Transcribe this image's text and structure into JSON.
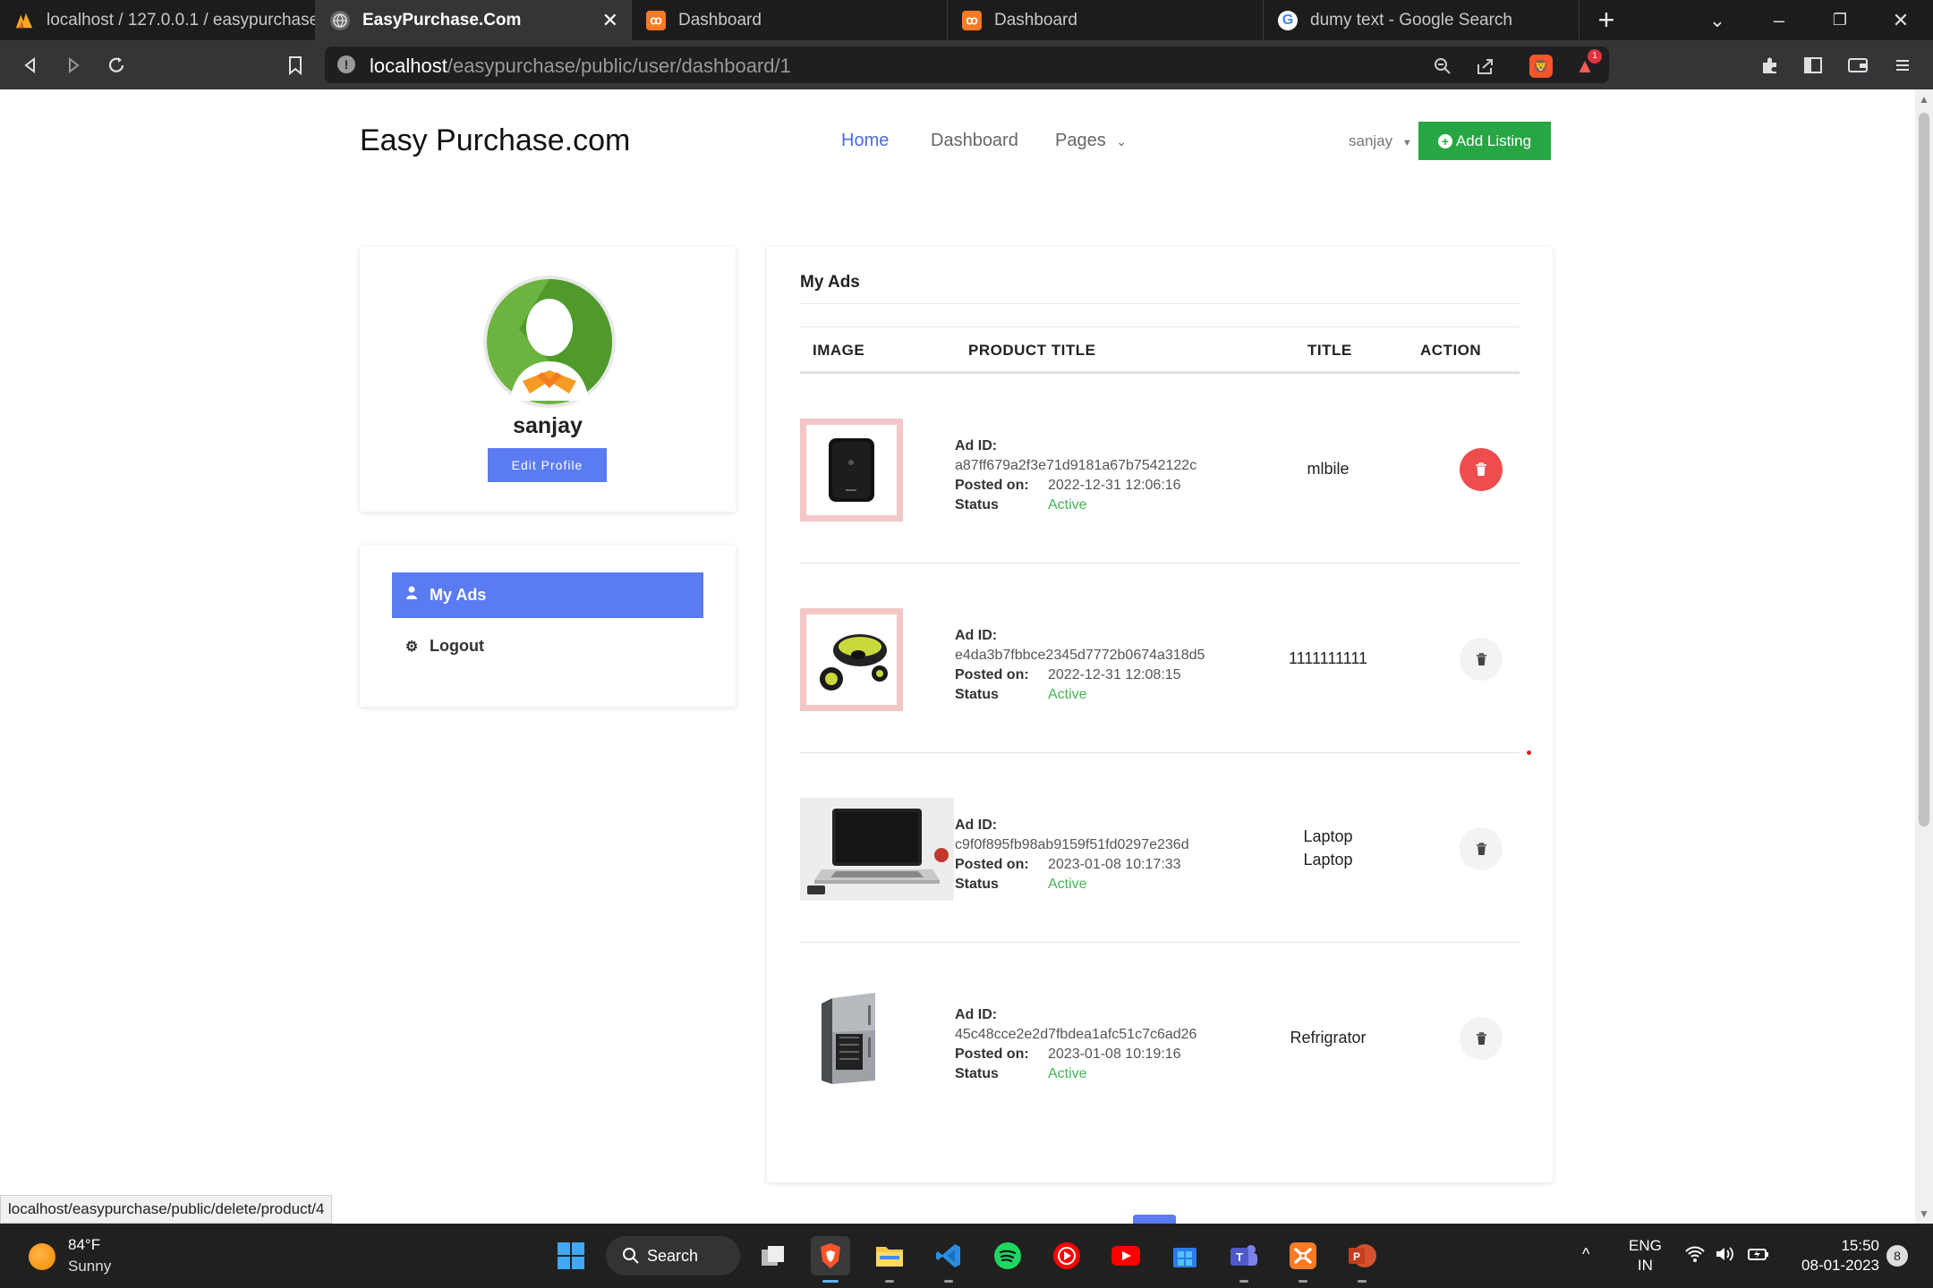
{
  "tabs": [
    {
      "label": "localhost / 127.0.0.1 / easypurchase /",
      "active": false
    },
    {
      "label": "EasyPurchase.Com",
      "active": true
    },
    {
      "label": "Dashboard",
      "active": false
    },
    {
      "label": "Dashboard",
      "active": false
    },
    {
      "label": "dumy text - Google Search",
      "active": false
    }
  ],
  "browser": {
    "url_host": "localhost",
    "url_path": "/easypurchase/public/user/dashboard/1",
    "bat_badge": "1",
    "status_url": "localhost/easypurchase/public/delete/product/4"
  },
  "site": {
    "brand": "Easy Purchase.com",
    "nav": {
      "home": "Home",
      "dashboard": "Dashboard",
      "pages": "Pages"
    },
    "user": "sanjay",
    "add_listing": "Add Listing"
  },
  "profile": {
    "name": "sanjay",
    "edit_label": "Edit Profile"
  },
  "menu": {
    "my_ads": "My Ads",
    "logout": "Logout"
  },
  "ads": {
    "title": "My Ads",
    "columns": {
      "image": "IMAGE",
      "product_title": "PRODUCT TITLE",
      "title": "TITLE",
      "action": "ACTION"
    },
    "labels": {
      "ad_id": "Ad ID:",
      "posted_on": "Posted on:",
      "status": "Status"
    },
    "rows": [
      {
        "image": "pocket-router",
        "ad_id": "a87ff679a2f3e71d9181a67b7542122c",
        "posted_on": "2022-12-31 12:06:16",
        "status": "Active",
        "title_line1": "mlbile",
        "title_line2": ""
      },
      {
        "image": "earbuds",
        "ad_id": "e4da3b7fbbce2345d7772b0674a318d5",
        "posted_on": "2022-12-31 12:08:15",
        "status": "Active",
        "title_line1": "1111111111",
        "title_line2": ""
      },
      {
        "image": "laptop",
        "ad_id": "c9f0f895fb98ab9159f51fd0297e236d",
        "posted_on": "2023-01-08 10:17:33",
        "status": "Active",
        "title_line1": "Laptop",
        "title_line2": "Laptop"
      },
      {
        "image": "refrigerator",
        "ad_id": "45c48cce2e2d7fbdea1afc51c7c6ad26",
        "posted_on": "2023-01-08 10:19:16",
        "status": "Active",
        "title_line1": "Refrigrator",
        "title_line2": ""
      }
    ]
  },
  "taskbar": {
    "weather_temp": "84°F",
    "weather_cond": "Sunny",
    "search_label": "Search",
    "lang_line1": "ENG",
    "lang_line2": "IN",
    "time": "15:50",
    "date": "08-01-2023",
    "notifications": "8"
  },
  "colors": {
    "accent": "#5b7bf2",
    "success": "#27a744",
    "danger": "#ef4d4d",
    "status_active": "#44b556"
  }
}
